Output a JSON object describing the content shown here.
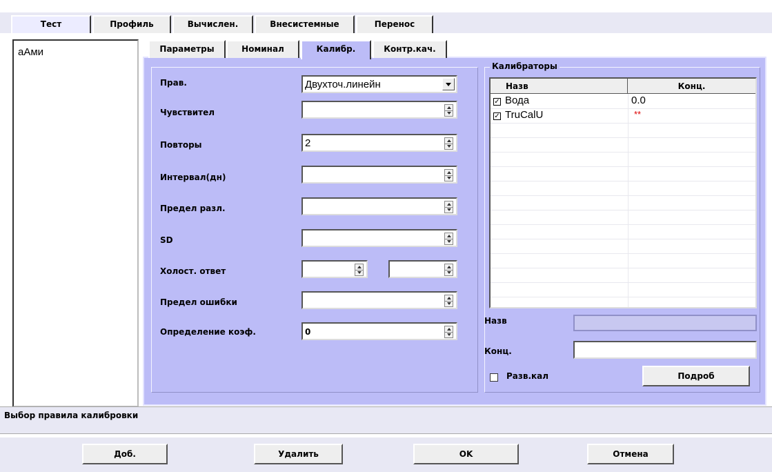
{
  "top_tabs": [
    "Тест",
    "Профиль",
    "Вычислен.",
    "Внесистемные",
    "Перенос"
  ],
  "test_list": [
    "аАми"
  ],
  "inner_tabs": [
    "Параметры",
    "Номинал",
    "Калибр.",
    "Контр.кач."
  ],
  "form": {
    "rule_label": "Прав.",
    "rule_value": "Двухточ.линейн",
    "sensitivity_label": "Чувствител",
    "sensitivity_value": "",
    "repeats_label": "Повторы",
    "repeats_value": "2",
    "interval_label": "Интервал(дн)",
    "interval_value": "",
    "diff_limit_label": "Предел разл.",
    "diff_limit_value": "",
    "sd_label": "SD",
    "sd_value": "",
    "blank_label": "Холост. ответ",
    "blank_value_1": "",
    "blank_value_2": "",
    "error_limit_label": "Предел ошибки",
    "error_limit_value": "",
    "coef_label": "Определение коэф.",
    "coef_value": "0"
  },
  "calibrators": {
    "title": "Калибраторы",
    "col_name": "Назв",
    "col_conc": "Конц.",
    "rows": [
      {
        "name": "Вода",
        "conc": "0.0",
        "checked": true
      },
      {
        "name": "TruCalU",
        "conc": "**",
        "checked": true
      }
    ],
    "name_label": "Назв",
    "name_value": "",
    "conc_label": "Конц.",
    "conc_value": "",
    "expand_label": "Разв.кал",
    "details_button": "Подроб"
  },
  "status_text": "Выбор правила калибровки",
  "buttons": {
    "add": "Доб.",
    "delete": "Удалить",
    "ok": "OK",
    "cancel": "Отмена"
  },
  "colors": {
    "panel": "#bcbcf7",
    "missing_conc": "#dd0000"
  }
}
